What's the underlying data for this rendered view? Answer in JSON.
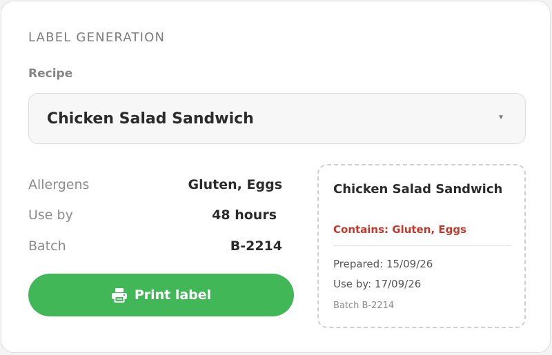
{
  "panel": {
    "title": "LABEL GENERATION"
  },
  "recipe": {
    "label": "Recipe",
    "selected": "Chicken Salad Sandwich"
  },
  "info": {
    "allergens": {
      "key": "Allergens",
      "value": "Gluten, Eggs"
    },
    "use_by": {
      "key": "Use by",
      "value": "48 hours"
    },
    "batch": {
      "key": "Batch",
      "value": "B-2214"
    }
  },
  "actions": {
    "print_label": "Print label",
    "print_icon": "printer-icon"
  },
  "preview": {
    "title": "Chicken Salad Sandwich",
    "allergens": "Contains: Gluten, Eggs",
    "prepared": "Prepared: 15/09/26",
    "use_by": "Use by: 17/09/26",
    "batch": "Batch B-2214"
  },
  "colors": {
    "accent_green": "#41b757",
    "allergen_red": "#c0392b"
  }
}
